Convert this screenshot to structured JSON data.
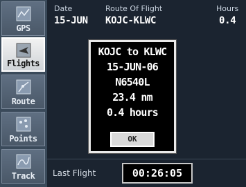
{
  "sidebar": {
    "items": [
      {
        "label": "GPS",
        "icon": "gps-icon",
        "active": false
      },
      {
        "label": "Flights",
        "icon": "flights-icon",
        "active": true
      },
      {
        "label": "Route",
        "icon": "route-icon",
        "active": false
      },
      {
        "label": "Points",
        "icon": "points-icon",
        "active": false
      },
      {
        "label": "Track",
        "icon": "track-icon",
        "active": false
      }
    ]
  },
  "table": {
    "headers": {
      "date": "Date",
      "route": "Route Of Flight",
      "hours": "Hours"
    },
    "row": {
      "date": "15-JUN",
      "route": "KOJC-KLWC",
      "hours": "0.4"
    }
  },
  "dialog": {
    "lines": [
      "KOJC to KLWC",
      "15-JUN-06",
      "N6540L",
      "23.4 nm",
      "0.4 hours"
    ],
    "ok_label": "OK"
  },
  "footer": {
    "last_flight_label": "Last Flight",
    "last_flight_time": "00:26:05"
  }
}
